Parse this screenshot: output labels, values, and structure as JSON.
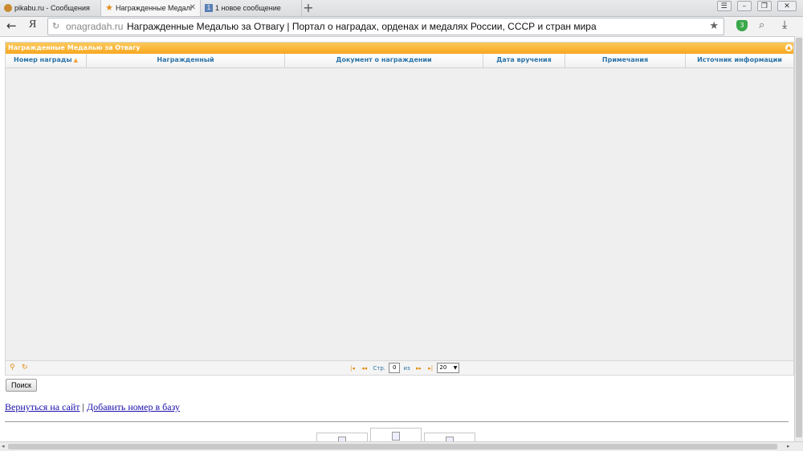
{
  "browser": {
    "tabs": [
      {
        "title": "pikabu.ru - Сообщения",
        "icon": "pikabu-favicon"
      },
      {
        "title": "Награжденные Медалі",
        "icon": "star-favicon",
        "active": true
      },
      {
        "title": "1 новое сообщение",
        "icon": "count-favicon",
        "badge": "1"
      }
    ],
    "new_tab": "+",
    "address": {
      "domain": "onagradah.ru",
      "page_title": "Награжденные Медалью за Отвагу | Портал о наградах, орденах и медалях России, СССР и стран мира"
    },
    "shield_badge": "3",
    "accent_colors": {
      "caption": "#f7a71f",
      "header_text": "#2a73a8",
      "shield": "#3aa84a"
    }
  },
  "grid": {
    "caption": "Награжденные Медалью за Отвагу",
    "columns": [
      {
        "label": "Номер награды",
        "sorted": true
      },
      {
        "label": "Награжденный"
      },
      {
        "label": "Документ о награждении"
      },
      {
        "label": "Дата вручения"
      },
      {
        "label": "Примечания"
      },
      {
        "label": "Источник информации"
      }
    ],
    "pager": {
      "page_label": "Стр.",
      "page_value": "0",
      "of_label": "из",
      "rows_per_page": "20"
    }
  },
  "search_button": "Поиск",
  "links": {
    "back": "Вернуться на сайт",
    "separator": "|",
    "add": "Добавить номер в базу"
  }
}
